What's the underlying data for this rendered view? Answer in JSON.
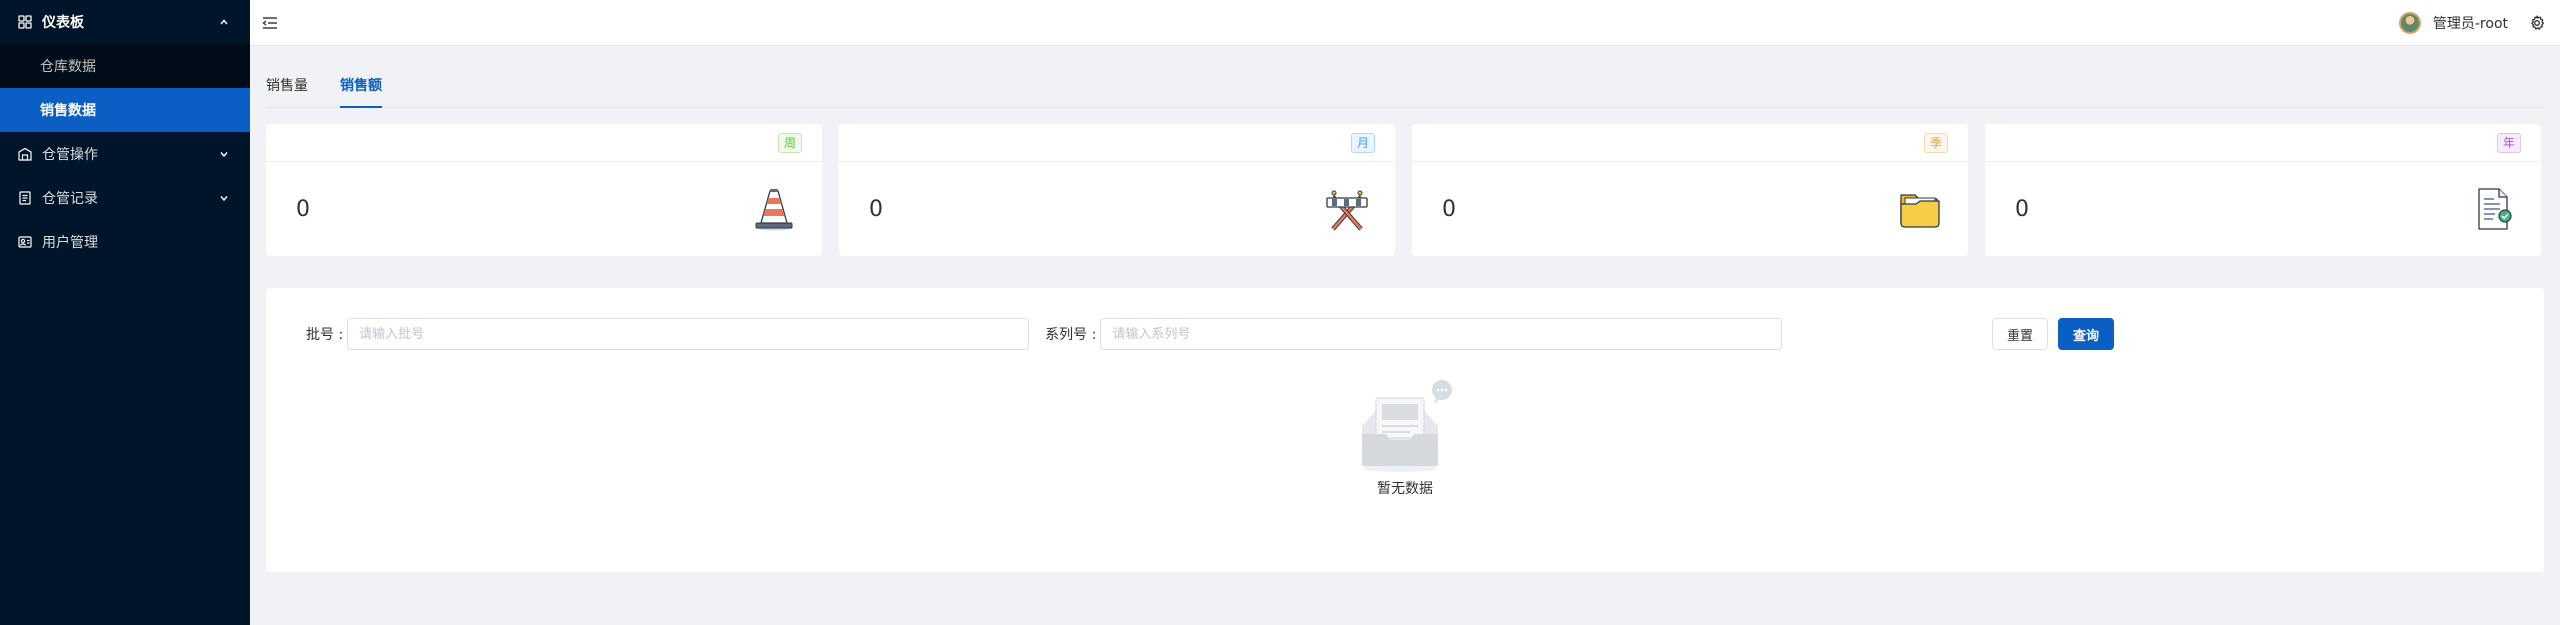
{
  "sidebar": {
    "items": [
      {
        "label": "仪表板",
        "icon": "dashboard-icon",
        "expanded": true,
        "children": [
          {
            "label": "仓库数据",
            "active": false
          },
          {
            "label": "销售数据",
            "active": true
          }
        ]
      },
      {
        "label": "仓管操作",
        "icon": "warehouse-icon",
        "expanded": false
      },
      {
        "label": "仓管记录",
        "icon": "record-icon",
        "expanded": false
      },
      {
        "label": "用户管理",
        "icon": "user-manage-icon",
        "expanded": false
      }
    ]
  },
  "header": {
    "user_name": "管理员-root"
  },
  "tabs": [
    {
      "label": "销售量",
      "active": false
    },
    {
      "label": "销售额",
      "active": true
    }
  ],
  "cards": [
    {
      "badge": "周",
      "value": "0",
      "icon": "traffic-cone-icon",
      "color": "#67c23a"
    },
    {
      "badge": "月",
      "value": "0",
      "icon": "barrier-icon",
      "color": "#409eff"
    },
    {
      "badge": "季",
      "value": "0",
      "icon": "folder-icon",
      "color": "#e6a23c"
    },
    {
      "badge": "年",
      "value": "0",
      "icon": "document-icon",
      "color": "#9b59d0"
    }
  ],
  "filters": {
    "batch_label": "批号 :",
    "batch_placeholder": "请输入批号",
    "series_label": "系列号 :",
    "series_placeholder": "请输入系列号",
    "reset_label": "重置",
    "query_label": "查询"
  },
  "empty": {
    "text": "暂无数据"
  },
  "colors": {
    "sidebar_bg": "#001529",
    "accent": "#0a5ec4"
  }
}
